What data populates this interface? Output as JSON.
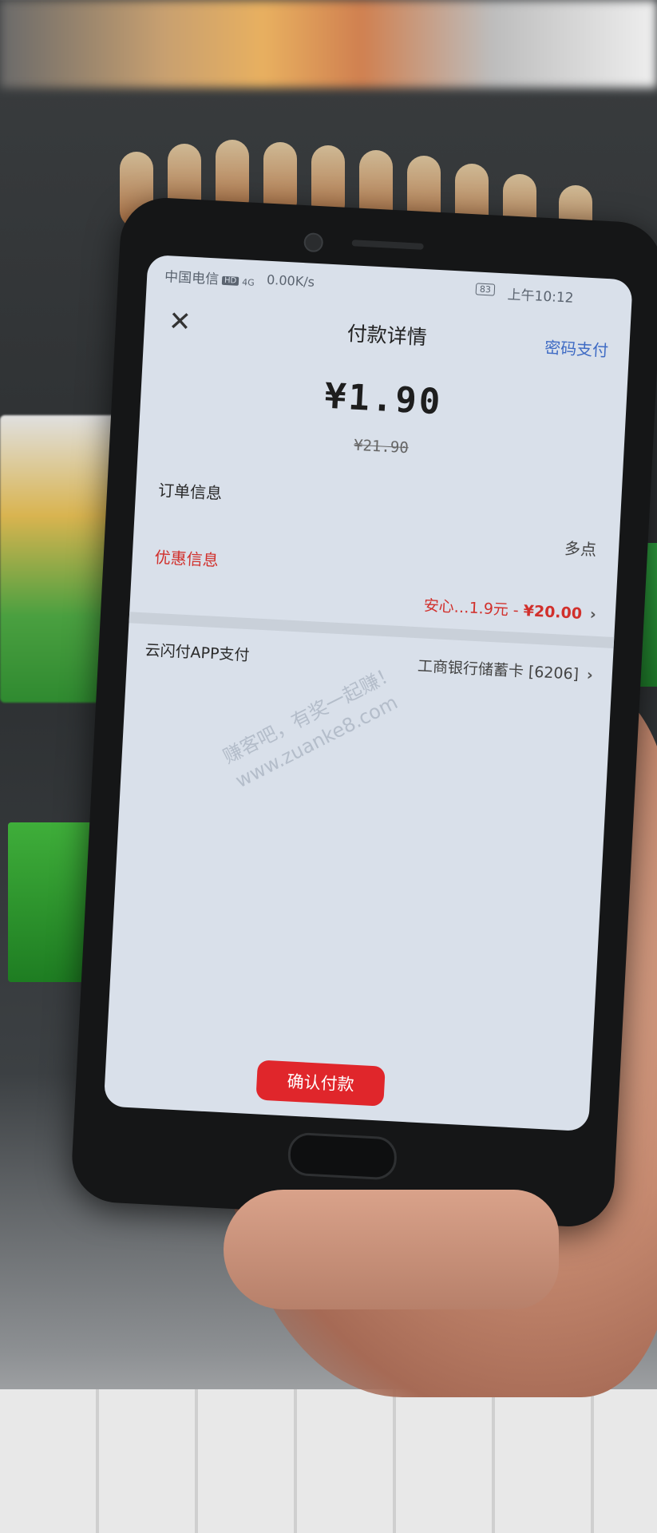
{
  "status_bar": {
    "carrier": "中国电信",
    "hd": "HD",
    "signal": "4G",
    "net_speed": "0.00K/s",
    "battery": "83",
    "time": "上午10:12"
  },
  "header": {
    "close_icon": "close-icon",
    "title": "付款详情",
    "password_pay": "密码支付"
  },
  "amount": {
    "pay": "¥1.90",
    "original": "¥21.90"
  },
  "order": {
    "label": "订单信息",
    "value": "多点"
  },
  "discount": {
    "label": "优惠信息",
    "desc": "安心…1.9元 - ",
    "price": "¥20.00",
    "chevron": "›"
  },
  "payment": {
    "label": "云闪付APP支付",
    "card": "工商银行储蓄卡 [6206]",
    "chevron": "›"
  },
  "watermark": {
    "line1": "赚客吧，有奖一起赚！",
    "line2": "www.zuanke8.com"
  },
  "confirm": {
    "label": "确认付款"
  },
  "colors": {
    "accent_red": "#e0262b",
    "link_blue": "#3f6bc4",
    "discount_red": "#d1302c"
  }
}
